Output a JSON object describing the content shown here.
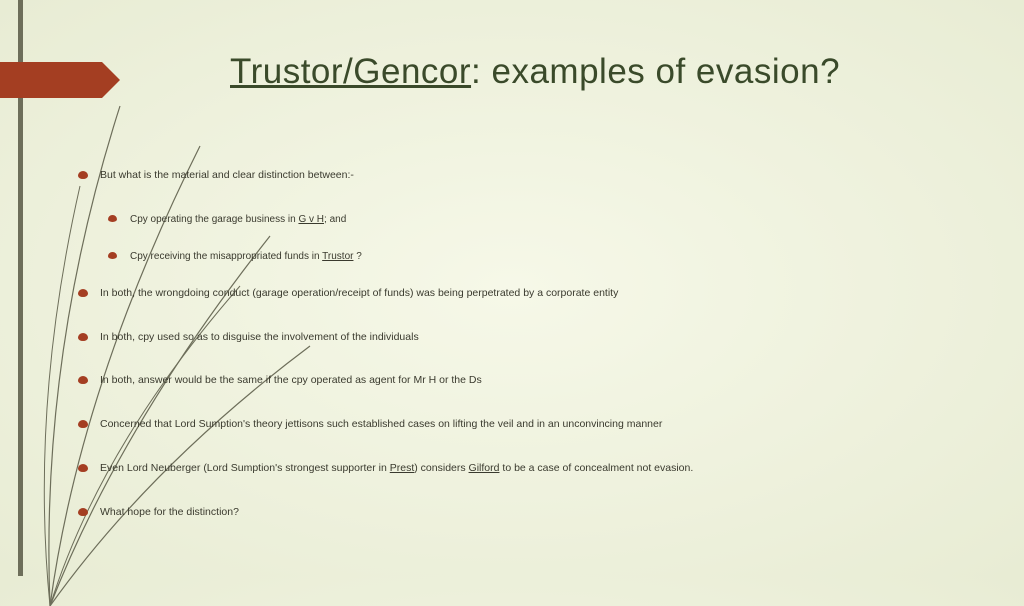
{
  "title": {
    "underlined": "Trustor/Gencor",
    "rest": ": examples of evasion?"
  },
  "bullets": {
    "b1": "But what is the material and clear distinction between:-",
    "b1a_pre": "Cpy operating the garage business in ",
    "b1a_u": "G v H",
    "b1a_post": "; and",
    "b1b_pre": "Cpy receiving the misappropriated funds in ",
    "b1b_u": "Trustor",
    "b1b_post": " ?",
    "b2": "In both, the wrongdoing conduct (garage operation/receipt of funds) was being perpetrated by a corporate entity",
    "b3": "In both, cpy used so as to disguise the involvement of the individuals",
    "b4": "In both, answer would be the same if the cpy operated as agent for Mr H or the Ds",
    "b5": "Concerned that Lord Sumption's theory jettisons such established cases on lifting the veil and in an unconvincing manner",
    "b6_pre": "Even Lord Neuberger (Lord Sumption's strongest supporter in ",
    "b6_u1": "Prest",
    "b6_mid": ") considers ",
    "b6_u2": "Gilford",
    "b6_post": " to be a case of concealment not evasion.",
    "b7": "What hope for the distinction?"
  }
}
